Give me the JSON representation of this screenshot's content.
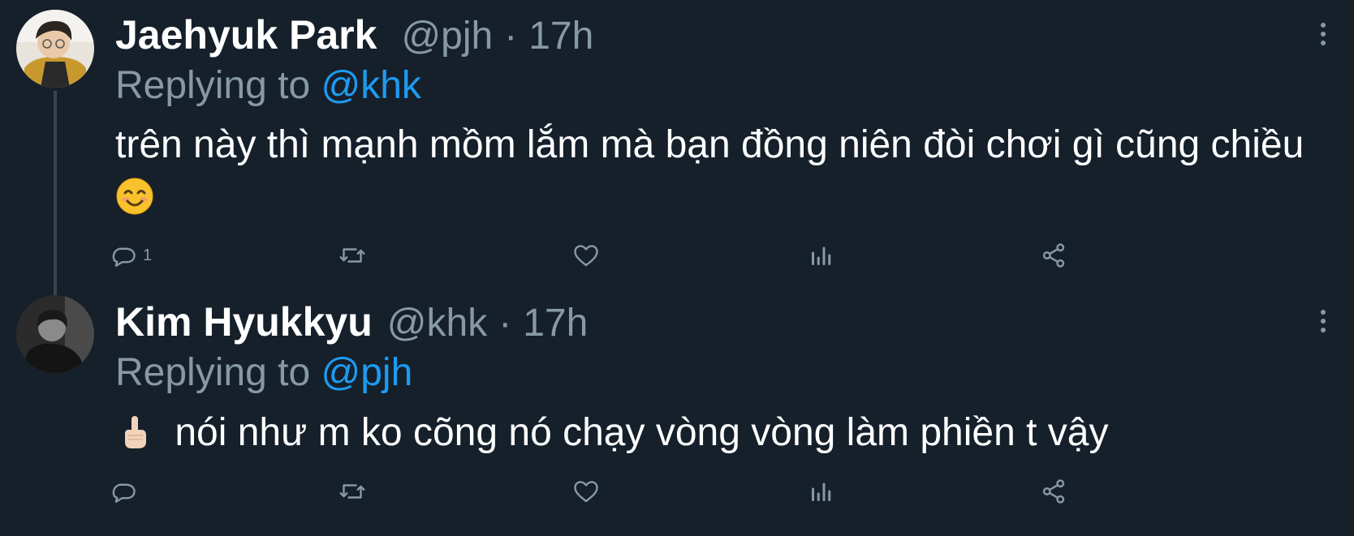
{
  "tweets": [
    {
      "name": "Jaehyuk Park",
      "handle": "@pjh",
      "separator": "·",
      "time": "17h",
      "reply_prefix": "Replying to",
      "reply_to": "@khk",
      "text": "trên này thì mạnh mồm lắm mà bạn đồng niên đòi chơi gì cũng chiều",
      "emoji": "smiling-face-emoji",
      "reply_count": "1"
    },
    {
      "name": "Kim Hyukkyu",
      "handle": "@khk",
      "separator": "·",
      "time": "17h",
      "reply_prefix": "Replying to",
      "reply_to": "@pjh",
      "text": "nói như m ko cõng nó chạy vòng vòng làm phiền t vậy",
      "emoji": "middle-finger-emoji"
    }
  ],
  "colors": {
    "background": "#15202b",
    "secondary_text": "#8899a6",
    "link": "#1d9bf0",
    "thread_line": "#38444d"
  },
  "icons": [
    "reply-icon",
    "retweet-icon",
    "like-icon",
    "views-icon",
    "share-icon",
    "more-icon"
  ]
}
